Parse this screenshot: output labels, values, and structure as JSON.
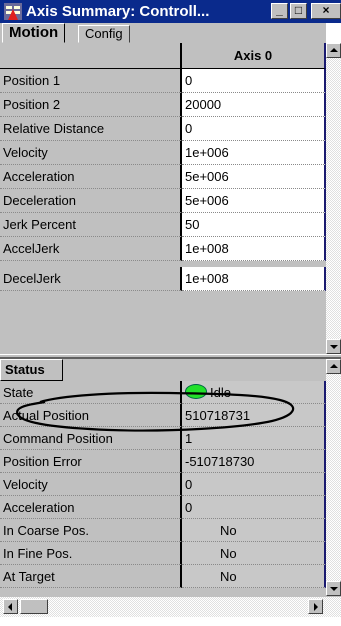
{
  "window": {
    "title": "Axis Summary: Controll...",
    "min_glyph": "_",
    "max_glyph": "□",
    "close_glyph": "×"
  },
  "tabs": [
    {
      "label": "Motion",
      "selected": true
    },
    {
      "label": "Config",
      "selected": false
    }
  ],
  "motion_grid": {
    "column_header": "Axis 0",
    "rows": [
      {
        "label": "Position 1",
        "value": "0"
      },
      {
        "label": "Position 2",
        "value": "20000"
      },
      {
        "label": "Relative Distance",
        "value": "0"
      },
      {
        "label": "Velocity",
        "value": "1e+006"
      },
      {
        "label": "Acceleration",
        "value": "5e+006"
      },
      {
        "label": "Deceleration",
        "value": "5e+006"
      },
      {
        "label": "Jerk Percent",
        "value": "50"
      },
      {
        "label": "AccelJerk",
        "value": "1e+008"
      },
      {
        "label": "DecelJerk",
        "value": "1e+008"
      }
    ]
  },
  "status_grid": {
    "header": "Status",
    "rows": [
      {
        "label": "State",
        "value": "Idle"
      },
      {
        "label": "Actual Position",
        "value": "510718731"
      },
      {
        "label": "Command Position",
        "value": "1"
      },
      {
        "label": "Position Error",
        "value": "-510718730"
      },
      {
        "label": "Velocity",
        "value": "0"
      },
      {
        "label": "Acceleration",
        "value": "0"
      },
      {
        "label": "In Coarse Pos.",
        "value": "No"
      },
      {
        "label": "In Fine Pos.",
        "value": "No"
      },
      {
        "label": "At Target",
        "value": "No"
      }
    ]
  },
  "colors": {
    "titlebar": "#0a2a8c",
    "state_indicator": "#22e02a",
    "annotation": "#000000"
  }
}
